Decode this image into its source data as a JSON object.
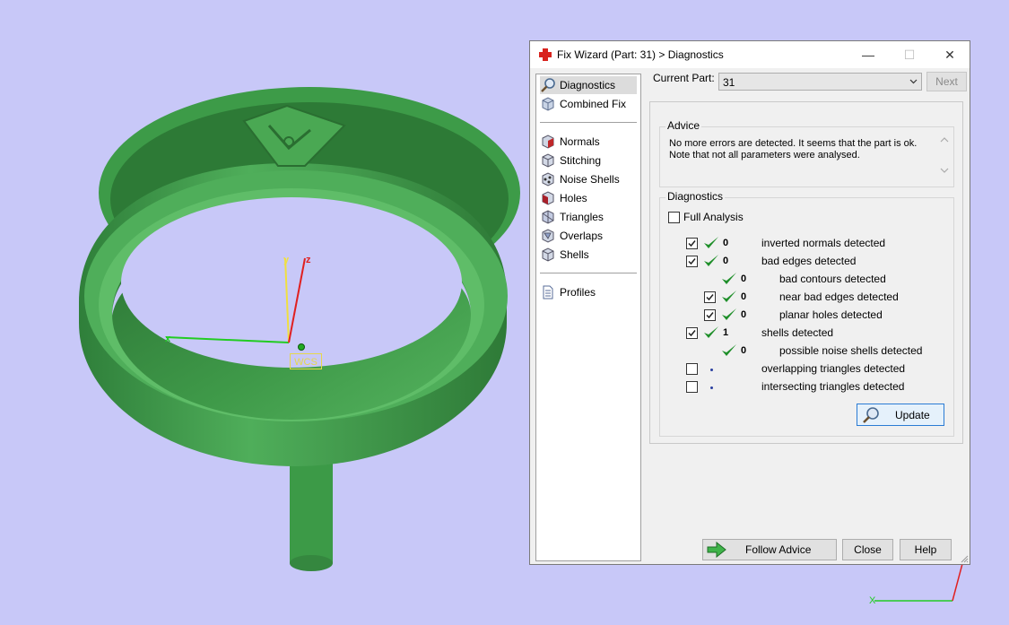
{
  "viewport": {
    "wcs_label": "WCS",
    "axis_x": "x",
    "axis_y": "y",
    "axis_z": "z",
    "corner_axis_x": "X"
  },
  "window": {
    "title": "Fix Wizard (Part: 31) > Diagnostics",
    "minimize": "—",
    "maximize": "☐",
    "close": "✕"
  },
  "nav": {
    "top": [
      {
        "label": "Diagnostics",
        "icon": "magnifier-icon",
        "selected": true
      },
      {
        "label": "Combined Fix",
        "icon": "cube-icon"
      }
    ],
    "items": [
      {
        "label": "Normals",
        "icon": "normals-icon"
      },
      {
        "label": "Stitching",
        "icon": "stitching-icon"
      },
      {
        "label": "Noise Shells",
        "icon": "noise-shells-icon"
      },
      {
        "label": "Holes",
        "icon": "holes-icon"
      },
      {
        "label": "Triangles",
        "icon": "triangles-icon"
      },
      {
        "label": "Overlaps",
        "icon": "overlaps-icon"
      },
      {
        "label": "Shells",
        "icon": "shells-icon"
      }
    ],
    "bottom": [
      {
        "label": "Profiles",
        "icon": "document-icon"
      }
    ]
  },
  "current_part": {
    "label": "Current Part:",
    "value": "31",
    "next": "Next"
  },
  "advice": {
    "title": "Advice",
    "text": "No more errors are detected. It seems that the part is ok. Note that not all parameters were analysed."
  },
  "diagnostics": {
    "title": "Diagnostics",
    "full_analysis": "Full Analysis",
    "rows": [
      {
        "checkbox": true,
        "checked": true,
        "status": "ok",
        "count": "0",
        "label": "inverted normals detected",
        "indent": 0
      },
      {
        "checkbox": true,
        "checked": true,
        "status": "ok",
        "count": "0",
        "label": "bad edges detected",
        "indent": 0
      },
      {
        "checkbox": false,
        "checked": false,
        "status": "ok",
        "count": "0",
        "label": "bad contours detected",
        "indent": 1
      },
      {
        "checkbox": true,
        "checked": true,
        "status": "ok",
        "count": "0",
        "label": "near bad edges detected",
        "indent": 1
      },
      {
        "checkbox": true,
        "checked": true,
        "status": "ok",
        "count": "0",
        "label": "planar holes detected",
        "indent": 1
      },
      {
        "checkbox": true,
        "checked": true,
        "status": "ok",
        "count": "1",
        "label": "shells detected",
        "indent": 0
      },
      {
        "checkbox": false,
        "checked": false,
        "status": "ok",
        "count": "0",
        "label": "possible noise shells detected",
        "indent": 1
      },
      {
        "checkbox": true,
        "checked": false,
        "status": "pending",
        "count": "",
        "label": "overlapping triangles detected",
        "indent": 0
      },
      {
        "checkbox": true,
        "checked": false,
        "status": "pending",
        "count": "",
        "label": "intersecting triangles detected",
        "indent": 0
      }
    ],
    "update": "Update"
  },
  "footer": {
    "follow_advice": "Follow Advice",
    "close": "Close",
    "help": "Help"
  },
  "colors": {
    "background": "#c8c8f8",
    "model_green": "#4caa56",
    "check_green": "#1f8f2a",
    "focus_blue": "#2a7bd4"
  }
}
